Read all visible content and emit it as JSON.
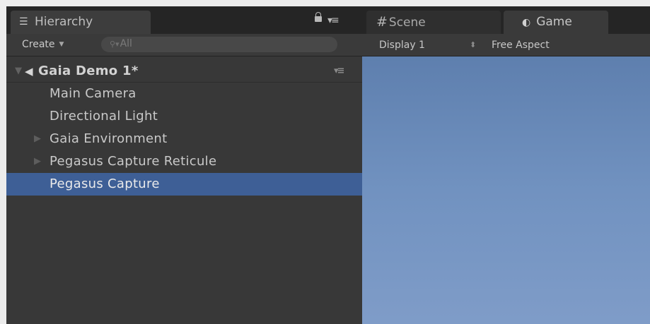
{
  "hierarchy": {
    "tab_label": "Hierarchy",
    "tab_icon": "list-icon",
    "create_label": "Create",
    "search": {
      "value": "",
      "placeholder": "All"
    },
    "scene": {
      "name": "Gaia Demo 1*"
    },
    "items": [
      {
        "label": "Main Camera",
        "expandable": false,
        "selected": false
      },
      {
        "label": "Directional Light",
        "expandable": false,
        "selected": false
      },
      {
        "label": "Gaia Environment",
        "expandable": true,
        "selected": false
      },
      {
        "label": "Pegasus Capture Reticule",
        "expandable": true,
        "selected": false
      },
      {
        "label": "Pegasus Capture",
        "expandable": false,
        "selected": true
      }
    ]
  },
  "view": {
    "tabs": [
      {
        "label": "Scene",
        "icon": "grid-icon",
        "active": false
      },
      {
        "label": "Game",
        "icon": "game-controller-icon",
        "active": true
      }
    ],
    "display": "Display 1",
    "aspect": "Free Aspect"
  },
  "colors": {
    "selection": "#3e5f96",
    "panel_bg": "#383838",
    "sky_top": "#5e7fae",
    "sky_bottom": "#7f9cc8"
  }
}
